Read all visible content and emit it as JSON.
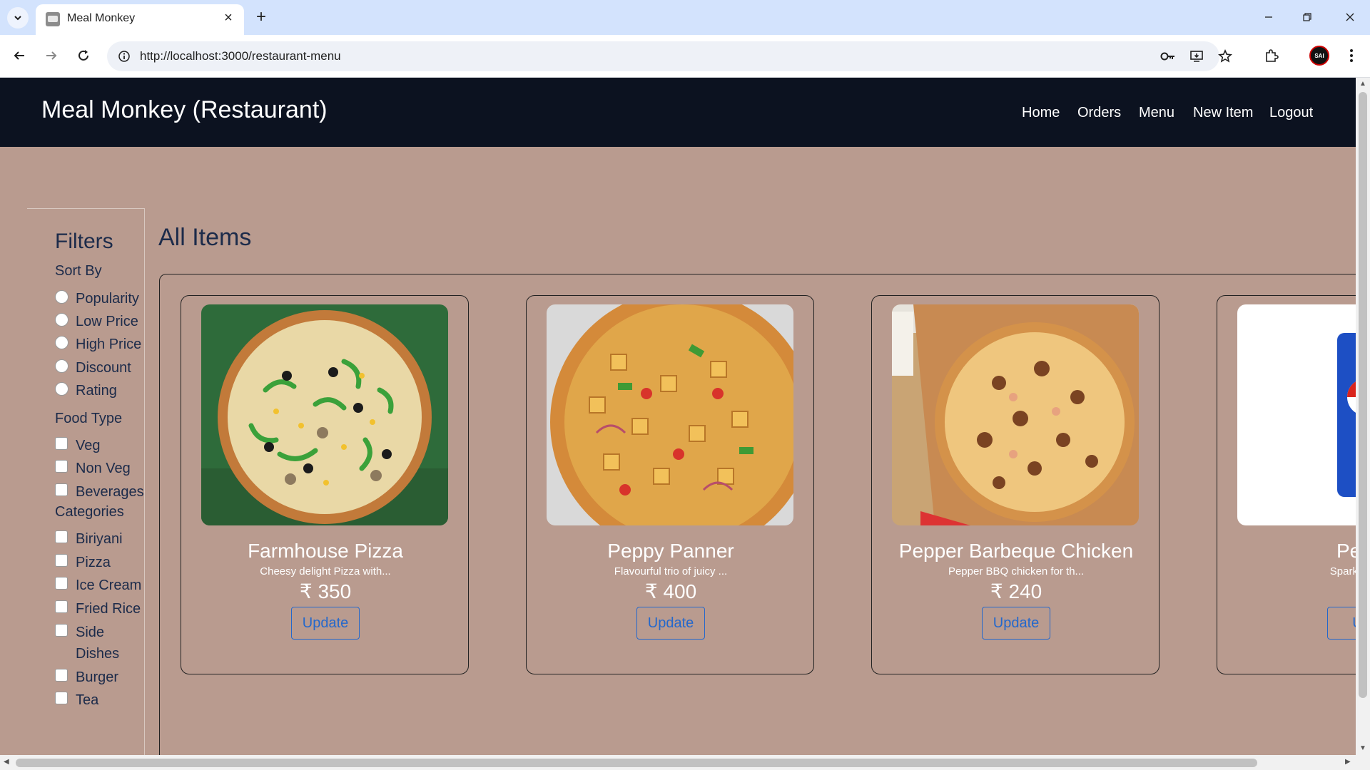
{
  "browser": {
    "tab_title": "Meal Monkey",
    "url": "http://localhost:3000/restaurant-menu",
    "avatar_text": "SAI"
  },
  "header": {
    "brand": "Meal Monkey (Restaurant)",
    "nav": [
      "Home",
      "Orders",
      "Menu",
      "New Item",
      "Logout"
    ]
  },
  "filters": {
    "title": "Filters",
    "sort_by": {
      "label": "Sort By",
      "options": [
        "Popularity",
        "Low Price",
        "High Price",
        "Discount",
        "Rating"
      ]
    },
    "food_type": {
      "label": "Food Type",
      "options": [
        "Veg",
        "Non Veg",
        "Beverages"
      ]
    },
    "categories": {
      "label": "Categories",
      "options": [
        "Biriyani",
        "Pizza",
        "Ice Cream",
        "Fried Rice",
        "Side",
        "Dishes",
        "Burger",
        "Tea"
      ]
    }
  },
  "main": {
    "title": "All Items",
    "items": [
      {
        "name": "Farmhouse Pizza",
        "desc": "Cheesy delight Pizza with...",
        "price": "₹ 350",
        "button": "Update"
      },
      {
        "name": "Peppy Panner",
        "desc": "Flavourful trio of juicy ...",
        "price": "₹ 400",
        "button": "Update"
      },
      {
        "name": "Pepper Barbeque Chicken",
        "desc": "Pepper BBQ chicken for th...",
        "price": "₹ 240",
        "button": "Update"
      },
      {
        "name": "Pepsi",
        "desc": "Sparking and",
        "price": "₹",
        "button": "Up"
      }
    ]
  },
  "colors": {
    "page_bg": "#b99b8f",
    "header_bg": "#0c1220",
    "accent": "#2468cc"
  }
}
